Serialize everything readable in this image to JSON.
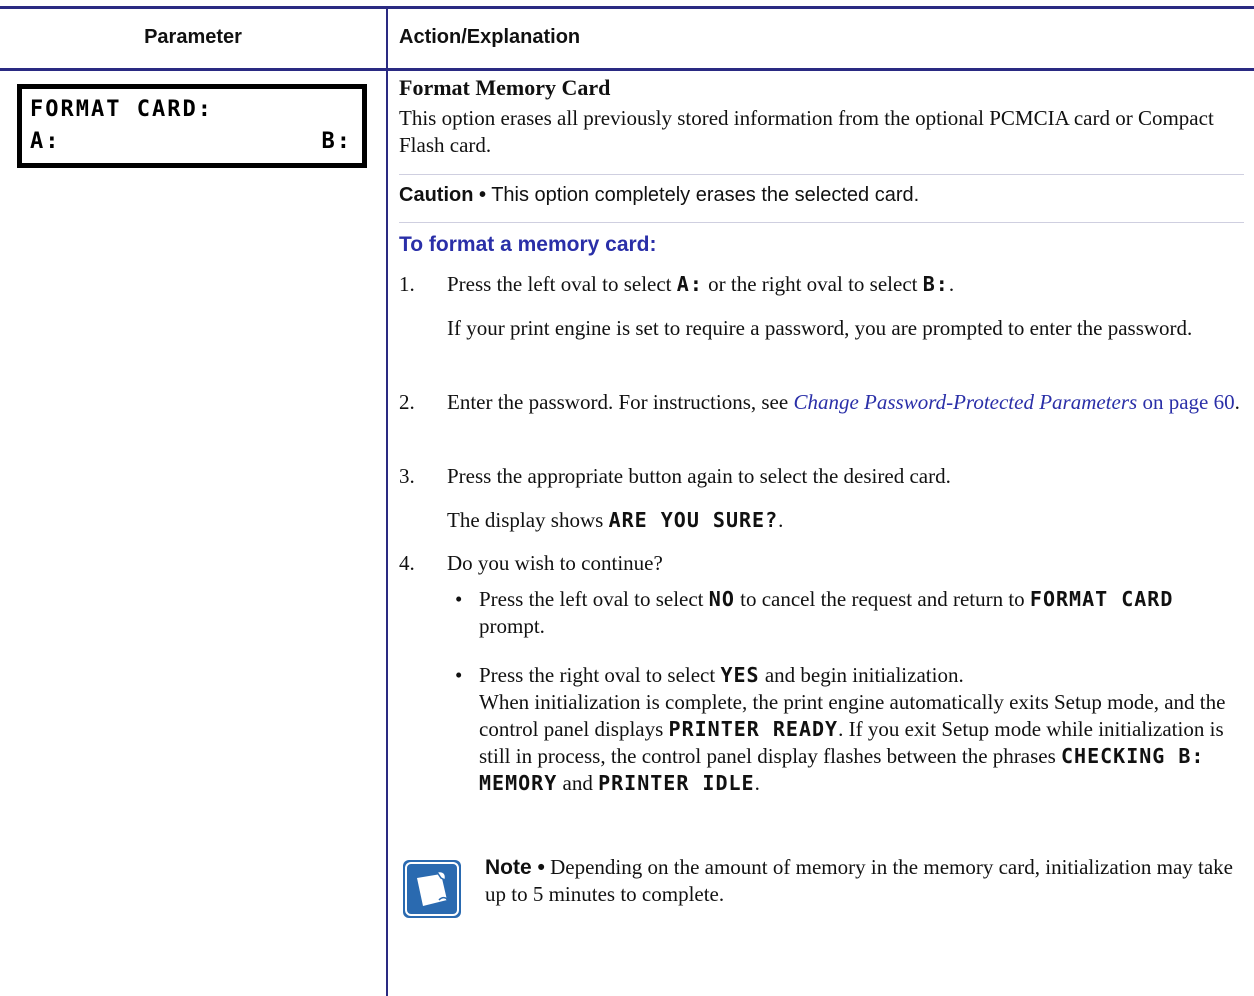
{
  "header": {
    "parameter": "Parameter",
    "action": "Action/Explanation"
  },
  "lcd": {
    "line1": "FORMAT CARD:",
    "line2_left": "A:",
    "line2_right": "B:"
  },
  "section": {
    "title": "Format Memory Card",
    "intro": "This option erases all previously stored information from the optional PCMCIA card or Compact Flash card.",
    "caution_label": "Caution •",
    "caution_text": " This option completely erases the selected card.",
    "procedure_title": "To format a memory card:"
  },
  "steps": {
    "s1_num": "1.",
    "s1_a": "Press the left oval to select ",
    "s1_code_a": "A:",
    "s1_b": " or the right oval to select ",
    "s1_code_b": "B:",
    "s1_c": ".",
    "s1_follow": "If your print engine is set to require a password, you are prompted to enter the password.",
    "s2_num": "2.",
    "s2_a": "Enter the password. For instructions, see ",
    "s2_link": "Change Password-Protected Parameters",
    "s2_link_page": " on page 60",
    "s2_c": ".",
    "s3_num": "3.",
    "s3_text": "Press the appropriate button again to select the desired card.",
    "s3_follow_a": "The display shows ",
    "s3_follow_code": "ARE YOU SURE?",
    "s3_follow_b": ".",
    "s4_num": "4.",
    "s4_text": "Do you wish to continue?"
  },
  "bullets": {
    "b1_a": "Press the left oval to select ",
    "b1_code": "NO",
    "b1_b": " to cancel the request and return to ",
    "b1_code2": "FORMAT CARD",
    "b1_c": " prompt.",
    "b2_a": "Press the right oval to select ",
    "b2_code": "YES",
    "b2_b": " and begin initialization.",
    "b2_c": "When initialization is complete, the print engine automatically exits Setup mode, and the control panel displays ",
    "b2_code2": "PRINTER READY",
    "b2_d": ". If you exit Setup mode while initialization is still in process, the control panel display flashes between the phrases ",
    "b2_code3": "CHECKING B: MEMORY",
    "b2_e": " and ",
    "b2_code4": "PRINTER IDLE",
    "b2_f": "."
  },
  "note": {
    "label": "Note •",
    "text": " Depending on the amount of memory in the memory card, initialization may take up to 5 minutes to complete."
  },
  "colors": {
    "rule": "#2a2a82",
    "heading_blue": "#2a2fa8",
    "note_icon": "#2a6ab0"
  },
  "icons": [
    "note-icon"
  ]
}
